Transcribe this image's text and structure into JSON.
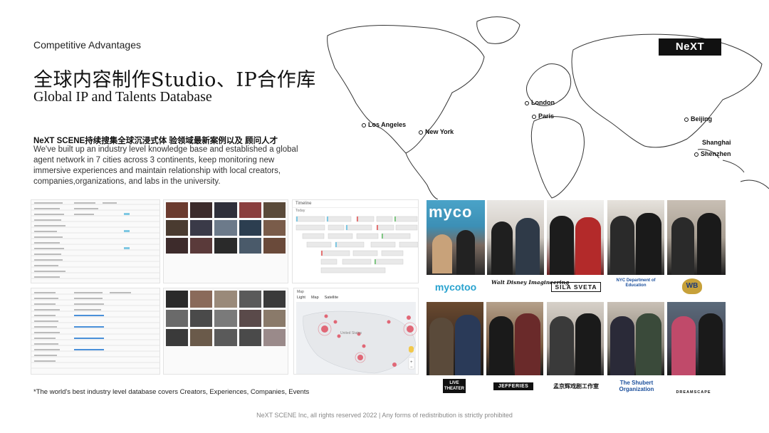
{
  "header": {
    "kicker": "Competitive Advantages",
    "title_cn": "全球内容制作Studio、IP合作库",
    "title_en": "Global IP and Talents Database"
  },
  "description": {
    "cn": "NeXT SCENE持续搜集全球沉浸式体 验领域最新案例以及 顾问人才",
    "en": "We've built up an industry level knowledge base and established a global agent network in 7 cities across 3 continents, keep monitoring new immersive experiences and maintain relationship with local creators, companies,organizations, and labs in the university."
  },
  "brand": {
    "logo_text": "NeXT SCENE"
  },
  "map": {
    "cities": [
      "Los Angeles",
      "New York",
      "London",
      "Paris",
      "Beijing",
      "Shanghai",
      "Shenzhen"
    ]
  },
  "partners": {
    "row1": [
      "mycotoo",
      "Walt Disney Imagineering",
      "SILA SVETA",
      "NYC Department of Education",
      "WB"
    ],
    "row2": [
      "LIVE THEATER",
      "JEFFERIES",
      "孟京辉戏剧工作室",
      "The Shubert Organization",
      "DREAMSCAPE"
    ]
  },
  "screens": {
    "timeline_title": "Timeline",
    "timeline_tab": "Today",
    "map_title": "Map",
    "map_tabs": [
      "Light",
      "Map",
      "Satellite"
    ],
    "map_label": "United States"
  },
  "footnote": "*The world's best  industry level database covers Creators, Experiences, Companies, Events",
  "footer": "NeXT SCENE Inc, all rights reserved 2022  |  Any forms of redistribution is strictly prohibited",
  "colors": {
    "accent_red": "#d84a5a",
    "logo_bg": "#111111"
  }
}
